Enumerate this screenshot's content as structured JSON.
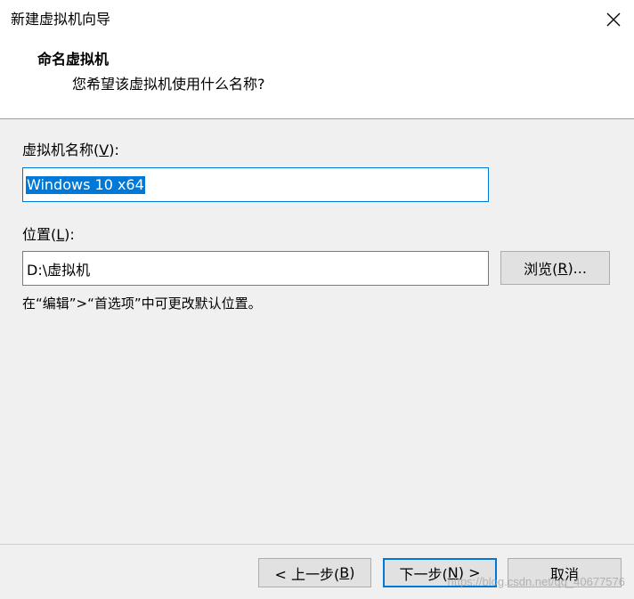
{
  "window": {
    "title": "新建虚拟机向导"
  },
  "header": {
    "title": "命名虚拟机",
    "subtitle": "您希望该虚拟机使用什么名称?"
  },
  "name_field": {
    "label_pre": "虚拟机名称(",
    "label_key": "V",
    "label_post": "):",
    "value": "Windows 10 x64"
  },
  "location_field": {
    "label_pre": "位置(",
    "label_key": "L",
    "label_post": "):",
    "value": "D:\\虚拟机"
  },
  "browse_button": {
    "label_pre": "浏览(",
    "label_key": "R",
    "label_post": ")..."
  },
  "hint": "在“编辑”>“首选项”中可更改默认位置。",
  "footer": {
    "back_pre": "< 上一步(",
    "back_key": "B",
    "back_post": ")",
    "next_pre": "下一步(",
    "next_key": "N",
    "next_post": ") >",
    "cancel": "取消"
  },
  "watermark": "https://blog.csdn.net/qq_40677576"
}
